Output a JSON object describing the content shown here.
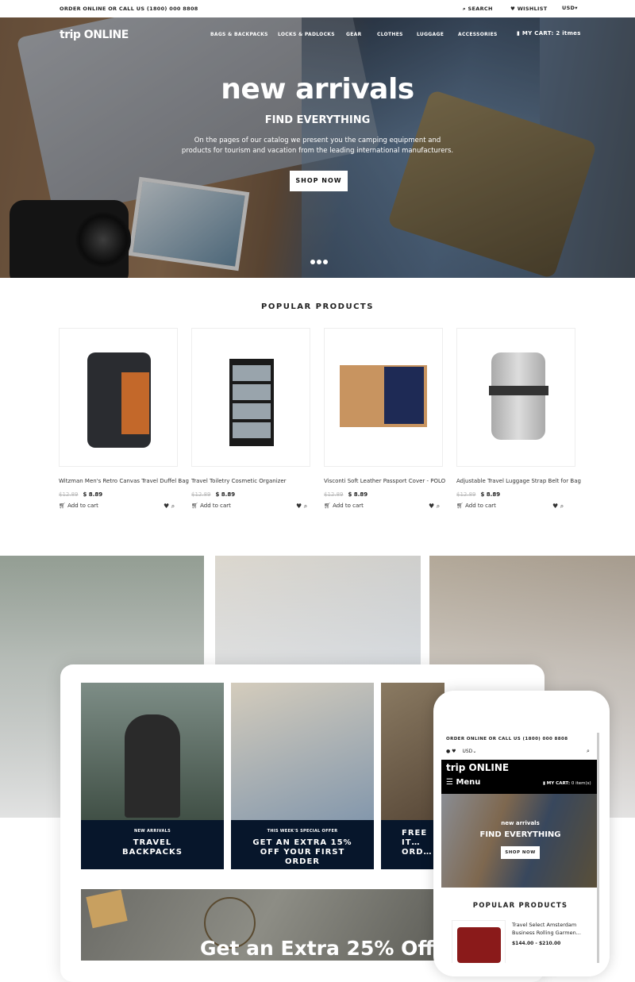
{
  "topbar": {
    "contact": "ORDER ONLINE OR CALL US (1800) 000 8808",
    "search": "SEARCH",
    "wishlist": "WISHLIST",
    "currency": "USD"
  },
  "header": {
    "logo": "trip ONLINE",
    "nav": [
      "BAGS & BACKPACKS",
      "LOCKS & PADLOCKS",
      "GEAR",
      "CLOTHES",
      "LUGGAGE",
      "ACCESSORIES"
    ],
    "cart": "MY CART: 2 itmes"
  },
  "hero": {
    "title": "new arrivals",
    "subtitle": "FIND EVERYTHING",
    "description": "On the pages of our catalog we present you the camping equipment and products for tourism and vacation from the leading international manufacturers.",
    "button": "SHOP NOW",
    "slides": 3,
    "active_slide": 1
  },
  "popular": {
    "title": "POPULAR PRODUCTS",
    "add_to_cart": "Add to cart",
    "products": [
      {
        "name": "Witzman Men's Retro Canvas Travel Duffel Bag",
        "old_price": "$12.89",
        "price": "$ 8.89"
      },
      {
        "name": "Travel Toiletry Cosmetic Organizer",
        "old_price": "$12.89",
        "price": "$ 8.89"
      },
      {
        "name": "Visconti Soft Leather Passport Cover - POLO",
        "old_price": "$12.89",
        "price": "$ 8.89"
      },
      {
        "name": "Adjustable Travel Luggage Strap Belt for Bag",
        "old_price": "$12.89",
        "price": "$ 8.89"
      }
    ]
  },
  "promos": [
    {
      "small": "NEW ARRIVALS",
      "big": "TRAVEL BACKPACKS"
    },
    {
      "small": "THIS WEEK'S SPECIAL OFFER",
      "big": "GET AN EXTRA 15% OFF YOUR FIRST ORDER"
    },
    {
      "small": "",
      "big": "FREE IT… ORD…"
    }
  ],
  "banner": {
    "title": "Get an Extra 25% Off"
  },
  "mobile": {
    "contact": "ORDER ONLINE OR CALL US (1800) 000 8808",
    "currency": "USD",
    "logo": "trip ONLINE",
    "menu": "Menu",
    "cart_label": "MY CART:",
    "cart_value": "0 item(s)",
    "hero_title": "new arrivals",
    "hero_sub": "FIND EVERYTHING",
    "button": "SHOP NOW",
    "section": "POPULAR PRODUCTS",
    "product_name": "Travel Select Amsterdam Business Rolling Garmen...",
    "product_price": "$144.00 - $210.00"
  },
  "colors": {
    "promo_caption": "#07162b",
    "hero_button": "#ffffff"
  }
}
